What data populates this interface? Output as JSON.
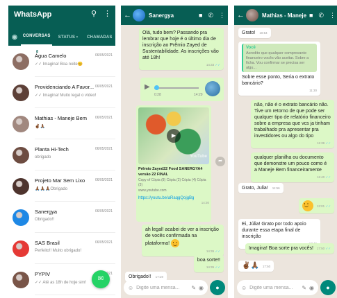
{
  "app": {
    "title": "WhatsApp",
    "tabs": {
      "camera": "◉",
      "conversas": "CONVERSAS",
      "conversas_badge": "8",
      "status": "STATUS •",
      "chamadas": "CHAMADAS"
    },
    "chats": [
      {
        "name": "Água Camelo",
        "preview": "✓✓ Imagina! Boa noite😊",
        "date": "06/05/2021",
        "color": "#8d6e63"
      },
      {
        "name": "Providenciando A Favor...",
        "preview": "✓✓ Imagina! Muito legal o vídeo!",
        "date": "06/05/2021",
        "color": "#5d4037"
      },
      {
        "name": "Mathias - Maneje Bem",
        "preview": "✌🏾🙏🏾",
        "date": "06/05/2021",
        "color": "#a1887f"
      },
      {
        "name": "Planta Hi-Tech",
        "preview": "obrigado",
        "date": "06/05/2021",
        "color": "#6d4c41"
      },
      {
        "name": "Projeto Mar Sem Lixo",
        "preview": "🙏🏾🙏🏾🙏🏾Obrigado",
        "date": "06/05/2021",
        "color": "#4e342e"
      },
      {
        "name": "Sanergya",
        "preview": "Obrigado!!",
        "date": "06/05/2021",
        "color": "#1e88e5"
      },
      {
        "name": "SAS Brasil",
        "preview": "Perfeito!! Muito obrigado!",
        "date": "06/05/2021",
        "color": "#e53935"
      },
      {
        "name": "PYPIV",
        "preview": "✓✓ Até as 18h de hoje sim!",
        "date": "06/05/2021",
        "color": "#795548"
      }
    ],
    "icons": {
      "search": "⚲",
      "more": "⋮",
      "fab": "✉"
    }
  },
  "chat2": {
    "name": "Sanergya",
    "messages": {
      "m1": "Olá, tudo bem? Passando pra lembrar que hoje é o último dia de inscrição ao Prêmio Zayed de Sustentabilidade. As inscrições vão até 18h!",
      "m1_time": "14:33",
      "audio_start": "0:28",
      "audio_time": "14:29",
      "card_title": "Prêmio Zayed22 Food SANERGYA4 versão 22 FINAL",
      "card_desc": "Copy of Cópia (8) Cópia (2) Cópia (4) Cópia (3)",
      "card_site": "www.youtube.com",
      "card_link": "https://youtu.be/aRaqgQojgBg",
      "card_time": "14:30",
      "yt": "YouTube",
      "m2": "ah legal! acabei de ver a inscrição de vocês confirmada na plataforma!",
      "m2_time": "14:35",
      "m3": "boa sorte!!",
      "m3_time": "14:35",
      "m4": "Obrigado!!",
      "m4_time": "17:19"
    },
    "placeholder": "Digite uma mensa..."
  },
  "chat3": {
    "name": "Mathias - Maneje...",
    "messages": {
      "m0": "Grato!",
      "m0_time": "10:54",
      "quote_name": "Você",
      "quote_text": "Acredito que qualquer comprovante financeiro vocês vão aceitar. Sobre a ficha. Vou confirmar se precisa ser algu...",
      "m1": "Sobre esse ponto, Seria o extrato bancário?",
      "m1_time": "11:30",
      "m2": "não, não é o extrato bancário não. Tive um retorno de que pode ser qualquer tipo de relatório financeiro sobre a empresa que vcs ja tinham trabalhado pra apresentar pra investidores ou algo do tipo",
      "m2_time": "11:39",
      "m3": "qualquer planilha ou documento que demonstre um pouco como é a Maneje Bem financeiramente",
      "m3_time": "11:40",
      "m4": "Grato, Julia!",
      "m4_time": "11:56",
      "m5_time": "12:01",
      "m6": "Ei, Júlia! Grato por todo apoio durante essa etapa final de inscrição",
      "m6_time": "17:49",
      "m7": "Imagina! Boa sorte pra vocês!",
      "m7_time": "17:50",
      "m8": "✌🏾🙏🏾",
      "m8_time": "17:50"
    },
    "placeholder": "Digite uma mensa..."
  },
  "colors": {
    "header": "#075e54",
    "accent": "#25d366",
    "outgoing": "#dcf8c6",
    "background": "#ece5dd"
  }
}
